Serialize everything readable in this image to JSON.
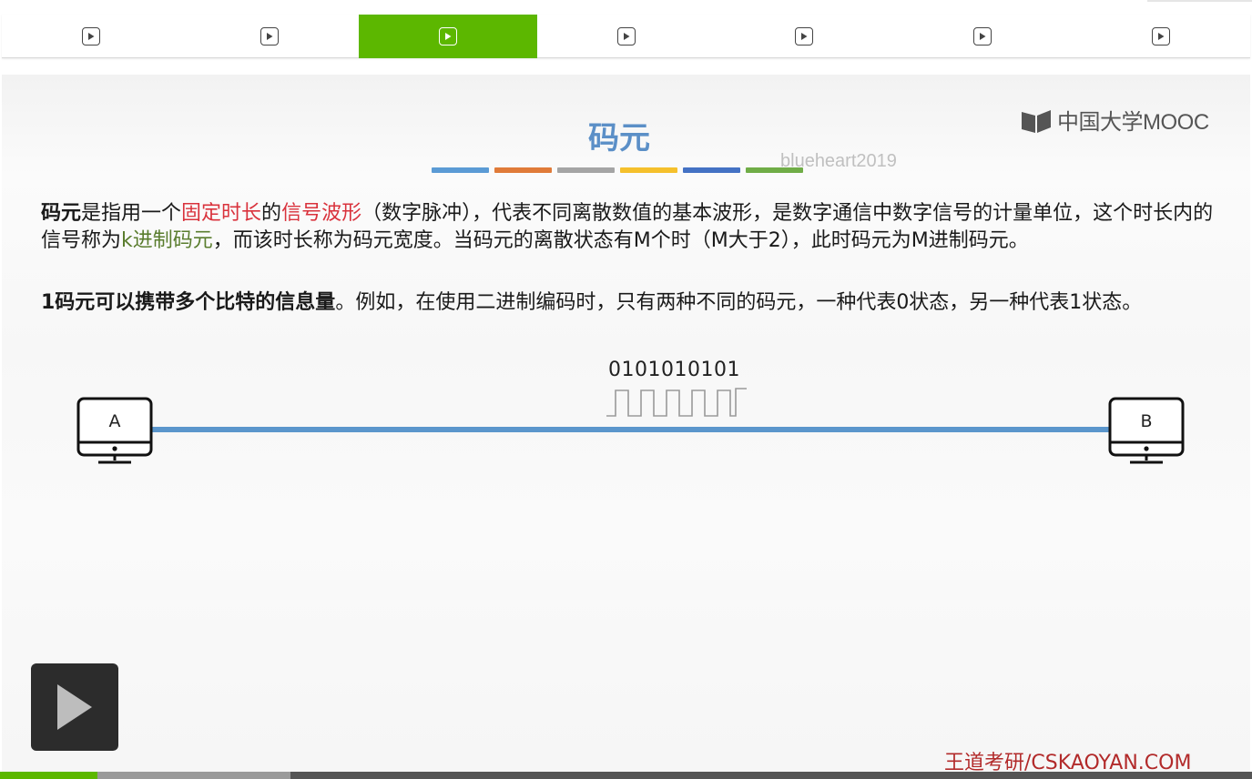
{
  "tabs": [
    {
      "icon": "play-icon",
      "active": false
    },
    {
      "icon": "play-icon",
      "active": false
    },
    {
      "icon": "play-icon",
      "active": true
    },
    {
      "icon": "play-icon",
      "active": false
    },
    {
      "icon": "play-icon",
      "active": false
    },
    {
      "icon": "play-icon",
      "active": false
    },
    {
      "icon": "play-icon",
      "active": false
    }
  ],
  "logo": {
    "text": "中国大学MOOC",
    "icon": "book-icon"
  },
  "slide": {
    "title": "码元",
    "watermark": "blueheart2019",
    "title_underline_colors": [
      "#5b9bd5",
      "#e07b39",
      "#a5a5a5",
      "#f5c02c",
      "#4472c4",
      "#70ad47"
    ],
    "para1": {
      "s1": "码元",
      "s2": "是指用一个",
      "s3": "固定时长",
      "s4": "的",
      "s5": "信号波形",
      "s6": "（数字脉冲），代表不同离散数值的基本波形，是数字通信中数字信号的计量单位，这个时长内的信号称为",
      "s7": "k进制码元",
      "s8": "，而该时长称为码元宽度。当码元的离散状态有M个时（M大于2），此时码元为M进制码元。"
    },
    "para2": {
      "s1": "1码元可以携带多个比特的信息量",
      "s2": "。例如，在使用二进制编码时，只有两种不同的码元，一种代表0状态，另一种代表1状态。"
    },
    "diagram": {
      "bits": "0101010101",
      "node_a": "A",
      "node_b": "B",
      "link_color": "#5b96cc"
    },
    "brand": "王道考研/CSKAOYAN.COM"
  },
  "player": {
    "play_icon": "play-icon",
    "progress_played": 0.078,
    "progress_buffered": 0.232
  },
  "colors": {
    "accent": "#5cb700",
    "title": "#5b8fc7",
    "highlight_red": "#d9323c",
    "highlight_green": "#5a7d2e",
    "brand": "#b22a2a"
  }
}
